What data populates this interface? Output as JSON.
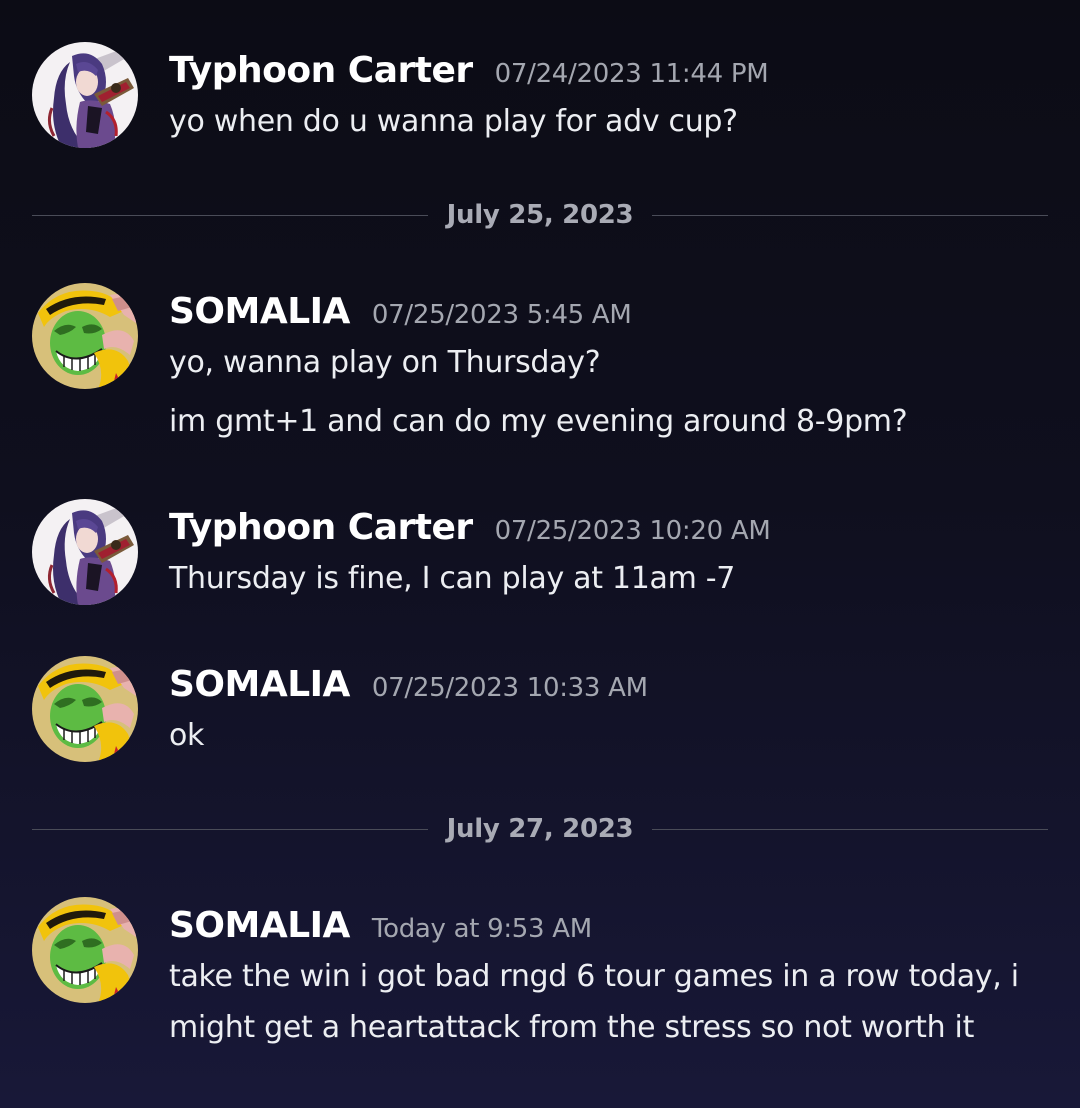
{
  "messages": [
    {
      "author": "Typhoon Carter",
      "avatar": "anime-character-avatar",
      "timestamp": "07/24/2023 11:44 PM",
      "lines": [
        "yo when do u wanna play for adv cup?"
      ]
    },
    {
      "author": "SOMALIA",
      "avatar": "green-mask-avatar",
      "timestamp": "07/25/2023 5:45 AM",
      "lines": [
        "yo, wanna play on Thursday?",
        "im gmt+1 and can do my evening around 8-9pm?"
      ]
    },
    {
      "author": "Typhoon Carter",
      "avatar": "anime-character-avatar",
      "timestamp": "07/25/2023 10:20 AM",
      "lines": [
        "Thursday is fine, I can play at 11am -7"
      ]
    },
    {
      "author": "SOMALIA",
      "avatar": "green-mask-avatar",
      "timestamp": "07/25/2023 10:33 AM",
      "lines": [
        "ok"
      ]
    },
    {
      "author": "SOMALIA",
      "avatar": "green-mask-avatar",
      "timestamp": "Today at 9:53 AM",
      "lines": [
        "take the win i got bad rngd 6 tour games in a row today, i",
        "might get a heartattack from the stress so not worth it"
      ]
    }
  ],
  "dividers": [
    {
      "date": "July 25, 2023"
    },
    {
      "date": "July 27, 2023"
    }
  ],
  "colors": {
    "background": "#0f0f1e",
    "username": "#ffffff",
    "timestamp": "#a4a7b0",
    "message_text": "#eceef2",
    "divider": "#4a4c58"
  }
}
